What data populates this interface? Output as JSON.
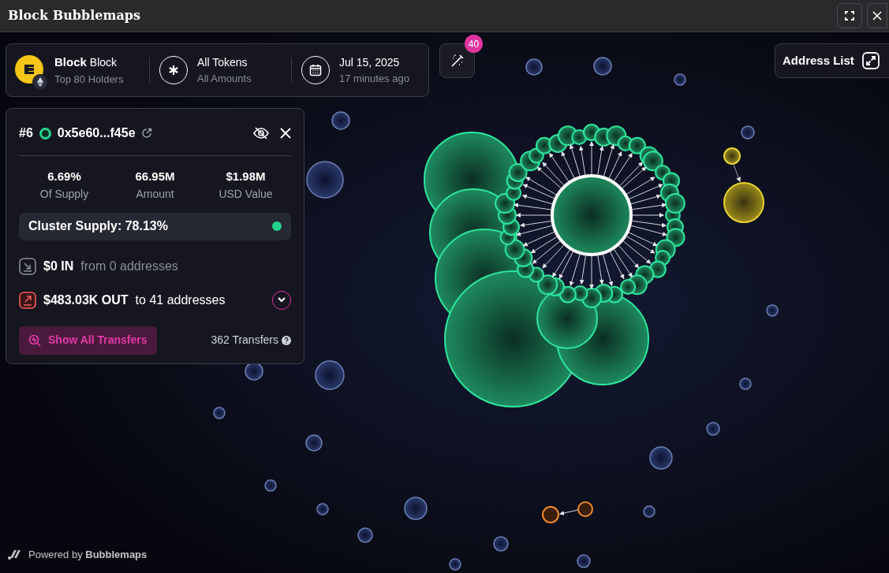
{
  "window": {
    "title": "Block Bubblemaps"
  },
  "token_bar": {
    "token": {
      "symbol": "Block",
      "name": "Block",
      "holders": "Top 80 Holders"
    },
    "filter": {
      "title": "All Tokens",
      "subtitle": "All Amounts"
    },
    "date": {
      "title": "Jul 15, 2025",
      "subtitle": "17 minutes ago"
    }
  },
  "magic_badge": "40",
  "address_list": "Address List",
  "details": {
    "rank": "#6",
    "address": "0x5e60...f45e",
    "stats": [
      {
        "value": "6.69%",
        "label": "Of Supply"
      },
      {
        "value": "66.95M",
        "label": "Amount"
      },
      {
        "value": "$1.98M",
        "label": "USD Value"
      }
    ],
    "cluster": "Cluster Supply: 78.13%",
    "inflow": {
      "amount": "$0 IN",
      "detail": "from 0 addresses"
    },
    "outflow": {
      "amount": "$483.03K OUT",
      "detail": "to 41 addresses"
    },
    "show_all": "Show All Transfers",
    "transfers": "362 Transfers"
  },
  "footer": "Powered by **Bubblemaps**"
}
